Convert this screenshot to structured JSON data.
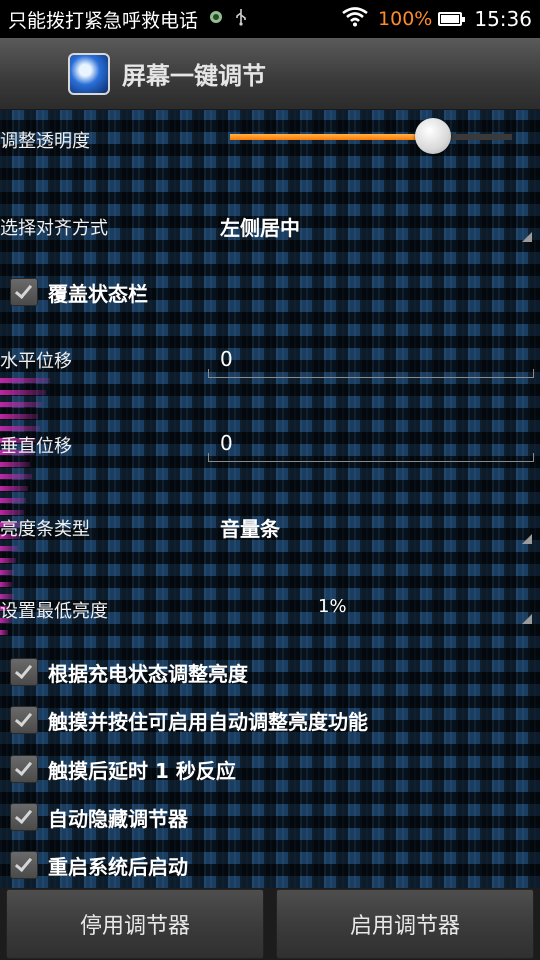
{
  "status_bar": {
    "carrier": "只能拨打紧急呼救电话",
    "battery_percent": "100%",
    "battery_color": "#ff8a2a",
    "time": "15:36",
    "icons": [
      "android-debug-icon",
      "usb-icon",
      "wifi-icon",
      "battery-icon"
    ]
  },
  "header": {
    "title": "屏幕一键调节",
    "app_icon": "app-icon"
  },
  "transparency": {
    "label": "调整透明度",
    "value_fraction": 0.72,
    "accent_color": "#ff8a00"
  },
  "alignment": {
    "label": "选择对齐方式",
    "value": "左侧居中"
  },
  "cover_statusbar": {
    "label": "覆盖状态栏",
    "checked": true
  },
  "horizontal_offset": {
    "label": "水平位移",
    "value": "0"
  },
  "vertical_offset": {
    "label": "垂直位移",
    "value": "0"
  },
  "brightness_bar_type": {
    "label": "亮度条类型",
    "value": "音量条"
  },
  "min_brightness": {
    "label": "设置最低亮度",
    "value": "1%"
  },
  "options": [
    {
      "label": "根据充电状态调整亮度",
      "checked": true
    },
    {
      "label": "触摸并按住可启用自动调整亮度功能",
      "checked": true
    },
    {
      "label": "触摸后延时 1 秒反应",
      "checked": true
    },
    {
      "label": "自动隐藏调节器",
      "checked": true
    },
    {
      "label": "重启系统后启动",
      "checked": true
    }
  ],
  "buttons": {
    "disable": "停用调节器",
    "enable": "启用调节器"
  }
}
